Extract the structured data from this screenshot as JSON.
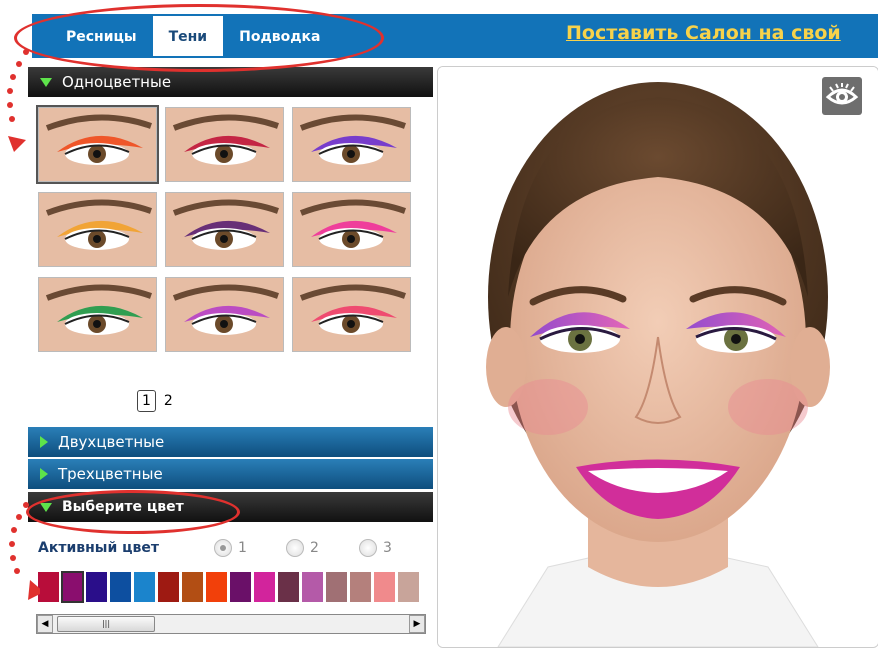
{
  "tabs": [
    {
      "label": "Ресницы",
      "active": false
    },
    {
      "label": "Тени",
      "active": true
    },
    {
      "label": "Подводка",
      "active": false
    }
  ],
  "promo_link": "Поставить Салон на свой",
  "sections": {
    "single": "Одноцветные",
    "double": "Двухцветные",
    "triple": "Трехцветные",
    "choose": "Выберите цвет"
  },
  "thumbnails": [
    {
      "color": "#f04a1c",
      "selected": true
    },
    {
      "color": "#c0143a",
      "selected": false
    },
    {
      "color": "#6a2fd0",
      "selected": false
    },
    {
      "color": "#f2a12a",
      "selected": false
    },
    {
      "color": "#5a1f72",
      "selected": false
    },
    {
      "color": "#f0309a",
      "selected": false
    },
    {
      "color": "#1c9a48",
      "selected": false
    },
    {
      "color": "#b63fc7",
      "selected": false
    },
    {
      "color": "#f03e6a",
      "selected": false
    }
  ],
  "pager": {
    "current": "1",
    "next": "2"
  },
  "active_color_label": "Активный цвет",
  "radios": [
    {
      "label": "1",
      "checked": true
    },
    {
      "label": "2",
      "checked": false
    },
    {
      "label": "3",
      "checked": false
    }
  ],
  "swatches": [
    "#b80d3a",
    "#8a0e6e",
    "#2a0e8a",
    "#0d4fa0",
    "#1b84cc",
    "#9e1a12",
    "#b24e14",
    "#f2400a",
    "#6a1068",
    "#d2249c",
    "#6a3048",
    "#b45aa8",
    "#a07074",
    "#b4807c",
    "#f08a8c",
    "#c8a49a"
  ],
  "icons": {
    "eye": "eye-icon",
    "left": "arrow-left-icon",
    "right": "arrow-right-icon"
  },
  "accent": "#e0312e"
}
